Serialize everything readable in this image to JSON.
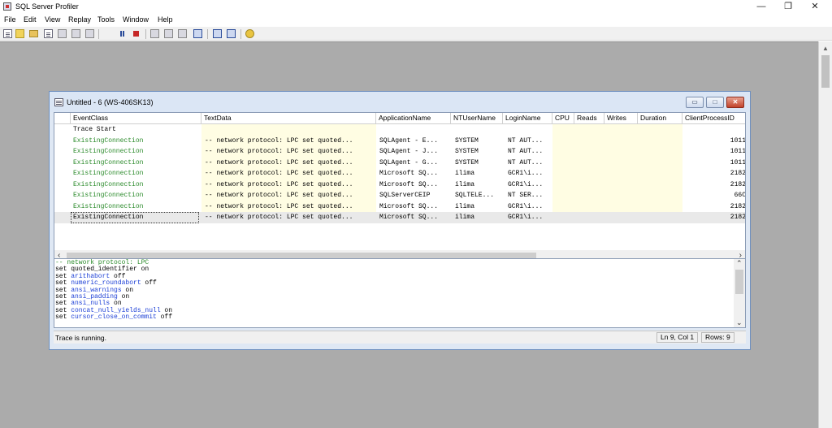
{
  "app": {
    "title": "SQL Server Profiler",
    "window_controls": {
      "minimize": "—",
      "restore": "❐",
      "close": "✕"
    }
  },
  "menu": [
    "File",
    "Edit",
    "View",
    "Replay",
    "Tools",
    "Window",
    "Help"
  ],
  "toolbar": {
    "icons": [
      "new-trace-icon",
      "new-template-icon",
      "open-icon",
      "save-icon",
      "properties-icon",
      "find-icon",
      "clear-icon",
      "start-icon",
      "pause-icon",
      "stop-icon",
      "column-filter-icon",
      "group-icon",
      "ungroup-icon",
      "auto-scroll-icon",
      "activity-monitor-icon",
      "performance-monitor-icon",
      "help-icon"
    ]
  },
  "trace_window": {
    "title": "Untitled - 6 (WS-406SK13)",
    "controls": {
      "minimize": "▭",
      "maximize": "□",
      "close": "✕"
    },
    "columns": [
      "EventClass",
      "TextData",
      "ApplicationName",
      "NTUserName",
      "LoginName",
      "CPU",
      "Reads",
      "Writes",
      "Duration",
      "ClientProcessID"
    ],
    "rows": [
      {
        "event": "Trace Start",
        "text": "",
        "app": "",
        "nt": "",
        "login": "",
        "pid": ""
      },
      {
        "event": "ExistingConnection",
        "text": "-- network protocol: LPC  set quoted...",
        "app": "SQLAgent - E...",
        "nt": "SYSTEM",
        "login": "NT AUT...",
        "pid": "1011"
      },
      {
        "event": "ExistingConnection",
        "text": "-- network protocol: LPC  set quoted...",
        "app": "SQLAgent - J...",
        "nt": "SYSTEM",
        "login": "NT AUT...",
        "pid": "1011"
      },
      {
        "event": "ExistingConnection",
        "text": "-- network protocol: LPC  set quoted...",
        "app": "SQLAgent - G...",
        "nt": "SYSTEM",
        "login": "NT AUT...",
        "pid": "1011"
      },
      {
        "event": "ExistingConnection",
        "text": "-- network protocol: LPC  set quoted...",
        "app": "Microsoft SQ...",
        "nt": "ilima",
        "login": "GCR1\\i...",
        "pid": "2182"
      },
      {
        "event": "ExistingConnection",
        "text": "-- network protocol: LPC  set quoted...",
        "app": "Microsoft SQ...",
        "nt": "ilima",
        "login": "GCR1\\i...",
        "pid": "2182"
      },
      {
        "event": "ExistingConnection",
        "text": "-- network protocol: LPC  set quoted...",
        "app": "SQLServerCEIP",
        "nt": "SQLTELE...",
        "login": "NT SER...",
        "pid": "66C"
      },
      {
        "event": "ExistingConnection",
        "text": "-- network protocol: LPC  set quoted...",
        "app": "Microsoft SQ...",
        "nt": "ilima",
        "login": "GCR1\\i...",
        "pid": "2182"
      },
      {
        "event": "ExistingConnection",
        "text": "-- network protocol: LPC  set quoted...",
        "app": "Microsoft SQ...",
        "nt": "ilima",
        "login": "GCR1\\i...",
        "pid": "2182"
      }
    ],
    "text_pane": [
      {
        "kw": "",
        "name": "-- network protocol: LPC",
        "val": ""
      },
      {
        "kw": "set ",
        "name": "quoted_identifier",
        "val": " on"
      },
      {
        "kw": "set ",
        "name": "arithabort",
        "val": " off"
      },
      {
        "kw": "set ",
        "name": "numeric_roundabort",
        "val": " off"
      },
      {
        "kw": "set ",
        "name": "ansi_warnings",
        "val": " on"
      },
      {
        "kw": "set ",
        "name": "ansi_padding",
        "val": " on"
      },
      {
        "kw": "set ",
        "name": "ansi_nulls",
        "val": " on"
      },
      {
        "kw": "set ",
        "name": "concat_null_yields_null",
        "val": " on"
      },
      {
        "kw": "set ",
        "name": "cursor_close_on_commit",
        "val": " off"
      }
    ],
    "status": {
      "message": "Trace is running.",
      "position": "Ln 9, Col 1",
      "rows": "Rows: 9"
    }
  }
}
